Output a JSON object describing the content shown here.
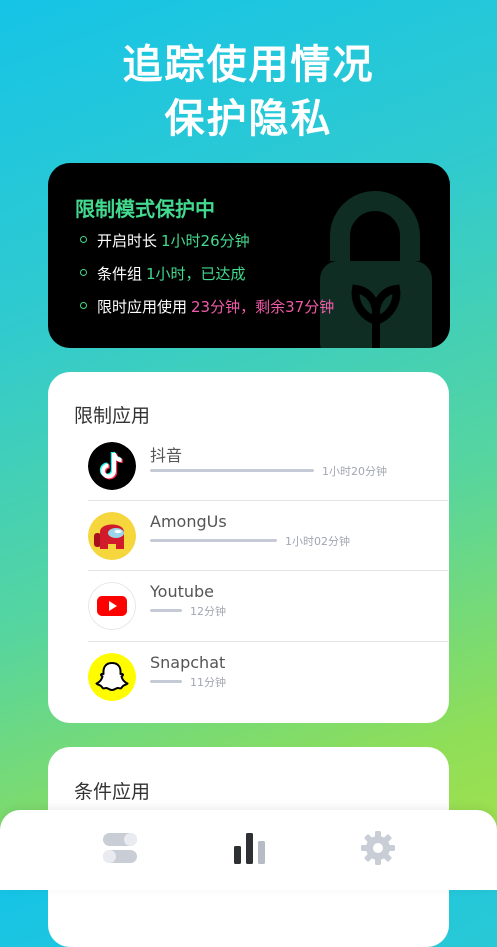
{
  "hero": {
    "line1": "追踪使用情况",
    "line2": "保护隐私"
  },
  "status_card": {
    "title": "限制模式保护中",
    "items": [
      {
        "label": "开启时长",
        "value": "1小时26分钟",
        "color": "#43d98e"
      },
      {
        "label": "条件组",
        "value": "1小时，已达成",
        "color": "#43d98e"
      },
      {
        "label": "限时应用使用",
        "value": "23分钟，剩余37分钟",
        "color": "#ef5ba8"
      }
    ]
  },
  "restricted_apps": {
    "title": "限制应用",
    "apps": [
      {
        "name": "抖音",
        "usage": "1小时20分钟",
        "minutes": 80,
        "icon": "tiktok-logo"
      },
      {
        "name": "AmongUs",
        "usage": "1小时02分钟",
        "minutes": 62,
        "icon": "among-us-logo"
      },
      {
        "name": "Youtube",
        "usage": "12分钟",
        "minutes": 12,
        "icon": "youtube-logo"
      },
      {
        "name": "Snapchat",
        "usage": "11分钟",
        "minutes": 11,
        "icon": "snapchat-logo"
      }
    ]
  },
  "condition_apps": {
    "title": "条件应用"
  },
  "tabbar": {
    "tabs": [
      {
        "icon": "toggle-icon",
        "active": false
      },
      {
        "icon": "bar-chart-icon",
        "active": true
      },
      {
        "icon": "gear-icon",
        "active": false
      }
    ]
  },
  "colors": {
    "accent_green": "#43d98e",
    "accent_pink": "#ef5ba8",
    "bar_gray": "#c6c9d6"
  }
}
